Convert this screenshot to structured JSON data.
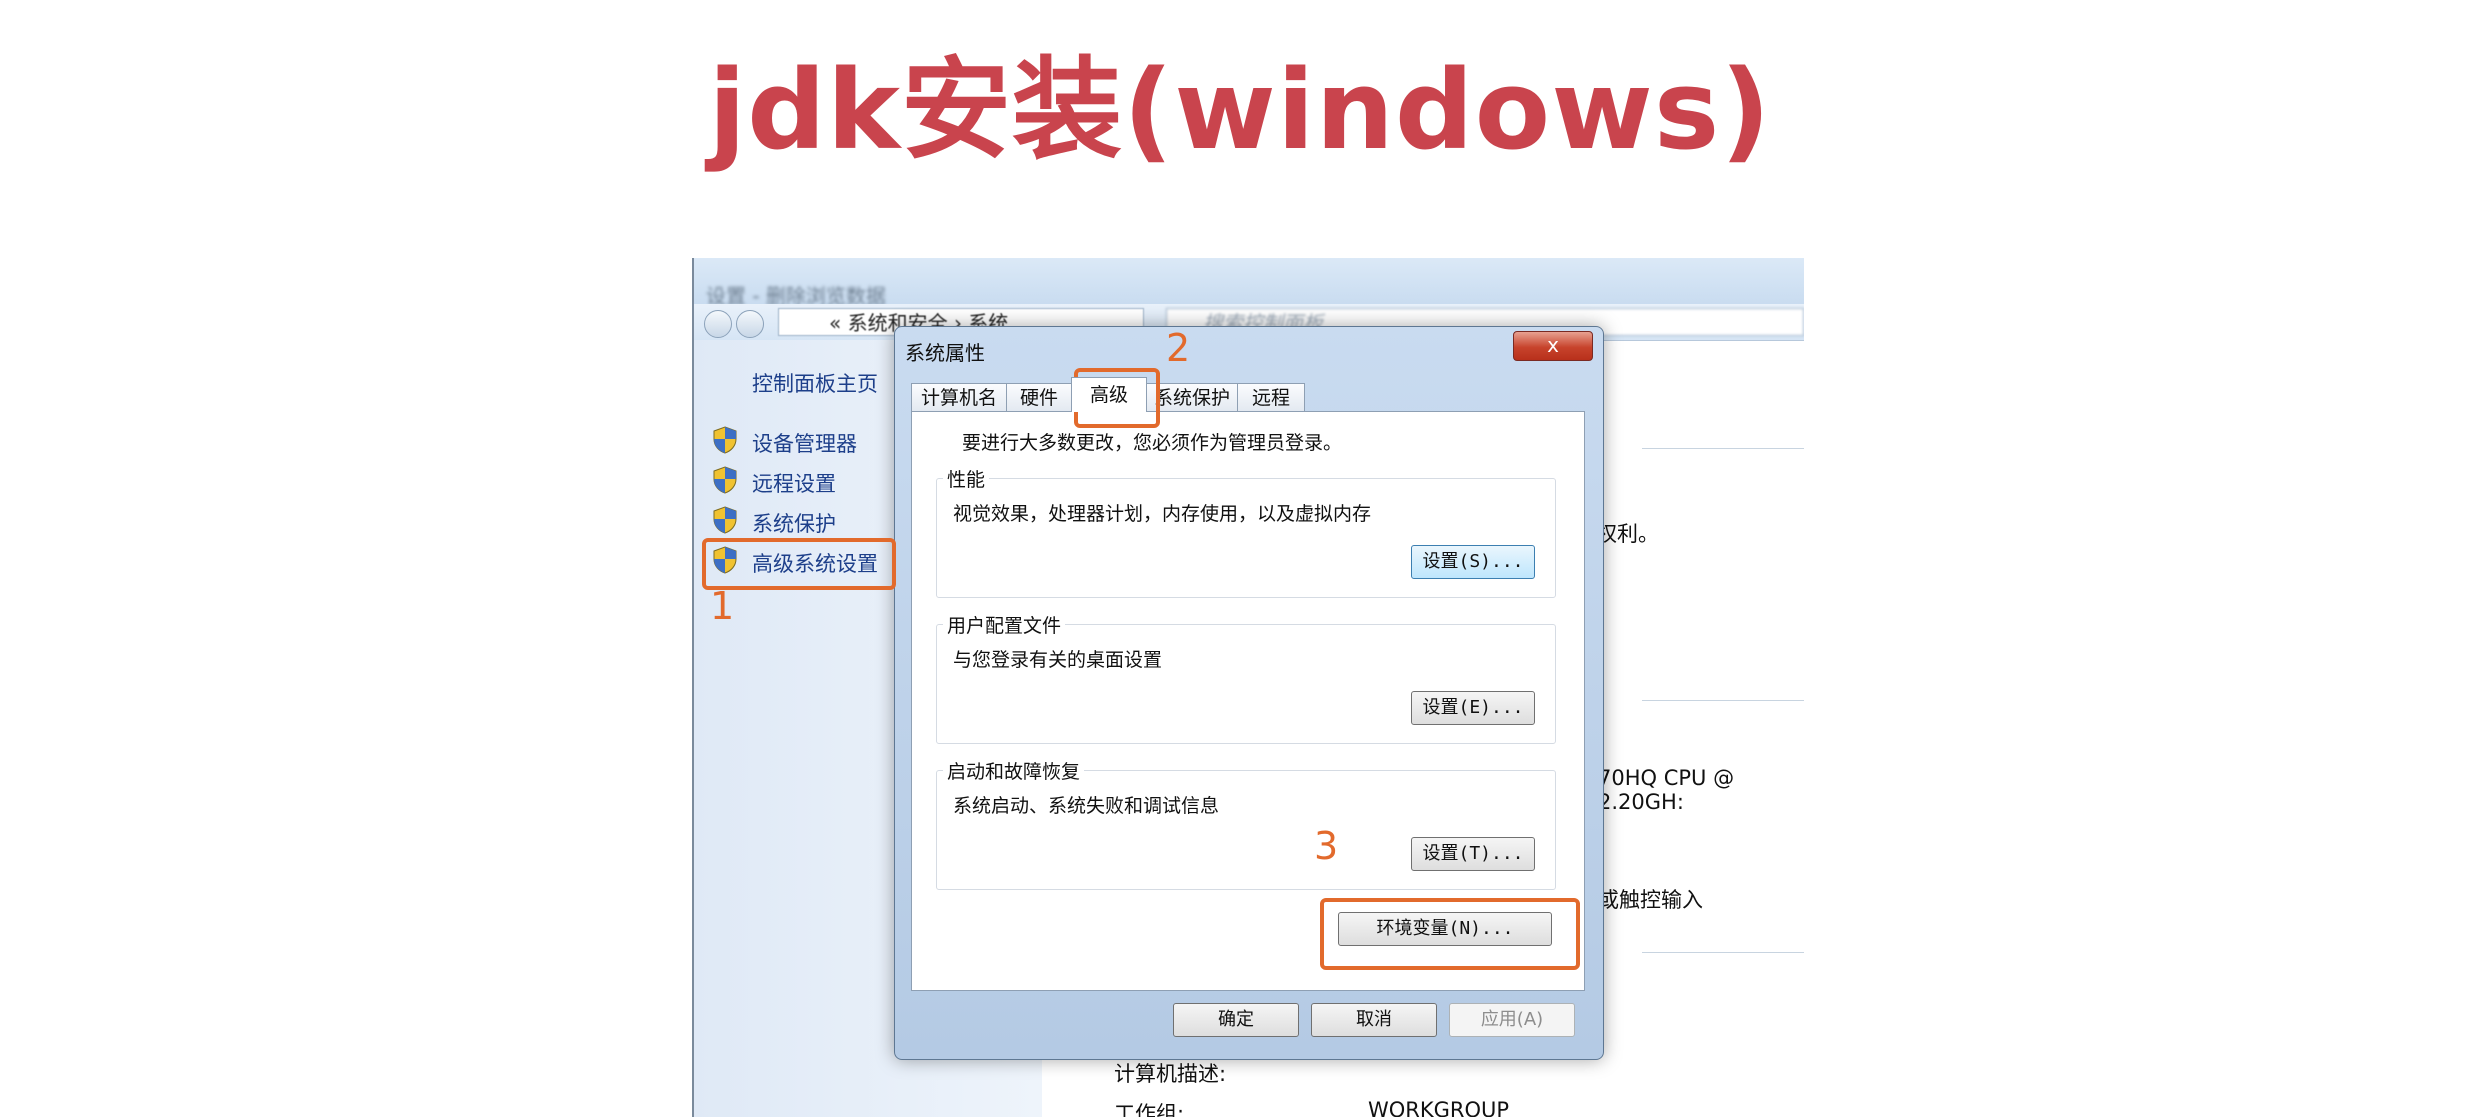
{
  "slide": {
    "title": "jdk安装(windows)"
  },
  "window": {
    "title_blurred": "设置 - 删除浏览数据",
    "breadcrumb": "« 系统和安全 › 系统",
    "search_placeholder": "搜索控制面板"
  },
  "sidebar": {
    "home": "控制面板主页",
    "items": [
      {
        "label": "设备管理器"
      },
      {
        "label": "远程设置"
      },
      {
        "label": "系统保护"
      },
      {
        "label": "高级系统设置"
      }
    ]
  },
  "background_text": {
    "rights": "权利。",
    "cpu": "70HQ CPU @ 2.20GH:",
    "touch": "或触控输入",
    "computer_desc": "计算机描述:",
    "workgroup_label": "工作组:",
    "workgroup_value": "WORKGROUP"
  },
  "dialog": {
    "title": "系统属性",
    "close_label": "x",
    "tabs": [
      {
        "label": "计算机名"
      },
      {
        "label": "硬件"
      },
      {
        "label": "高级",
        "active": true
      },
      {
        "label": "系统保护"
      },
      {
        "label": "远程"
      }
    ],
    "note": "要进行大多数更改，您必须作为管理员登录。",
    "groups": [
      {
        "title": "性能",
        "desc": "视觉效果，处理器计划，内存使用，以及虚拟内存",
        "button": "设置(S)..."
      },
      {
        "title": "用户配置文件",
        "desc": "与您登录有关的桌面设置",
        "button": "设置(E)..."
      },
      {
        "title": "启动和故障恢复",
        "desc": "系统启动、系统失败和调试信息",
        "button": "设置(T)..."
      }
    ],
    "env_button": "环境变量(N)...",
    "ok": "确定",
    "cancel": "取消",
    "apply": "应用(A)"
  },
  "annotations": [
    {
      "number": "1"
    },
    {
      "number": "2"
    },
    {
      "number": "3"
    }
  ],
  "colors": {
    "title": "#c9444d",
    "annotation": "#e26a2c",
    "link": "#1d3f8a"
  }
}
